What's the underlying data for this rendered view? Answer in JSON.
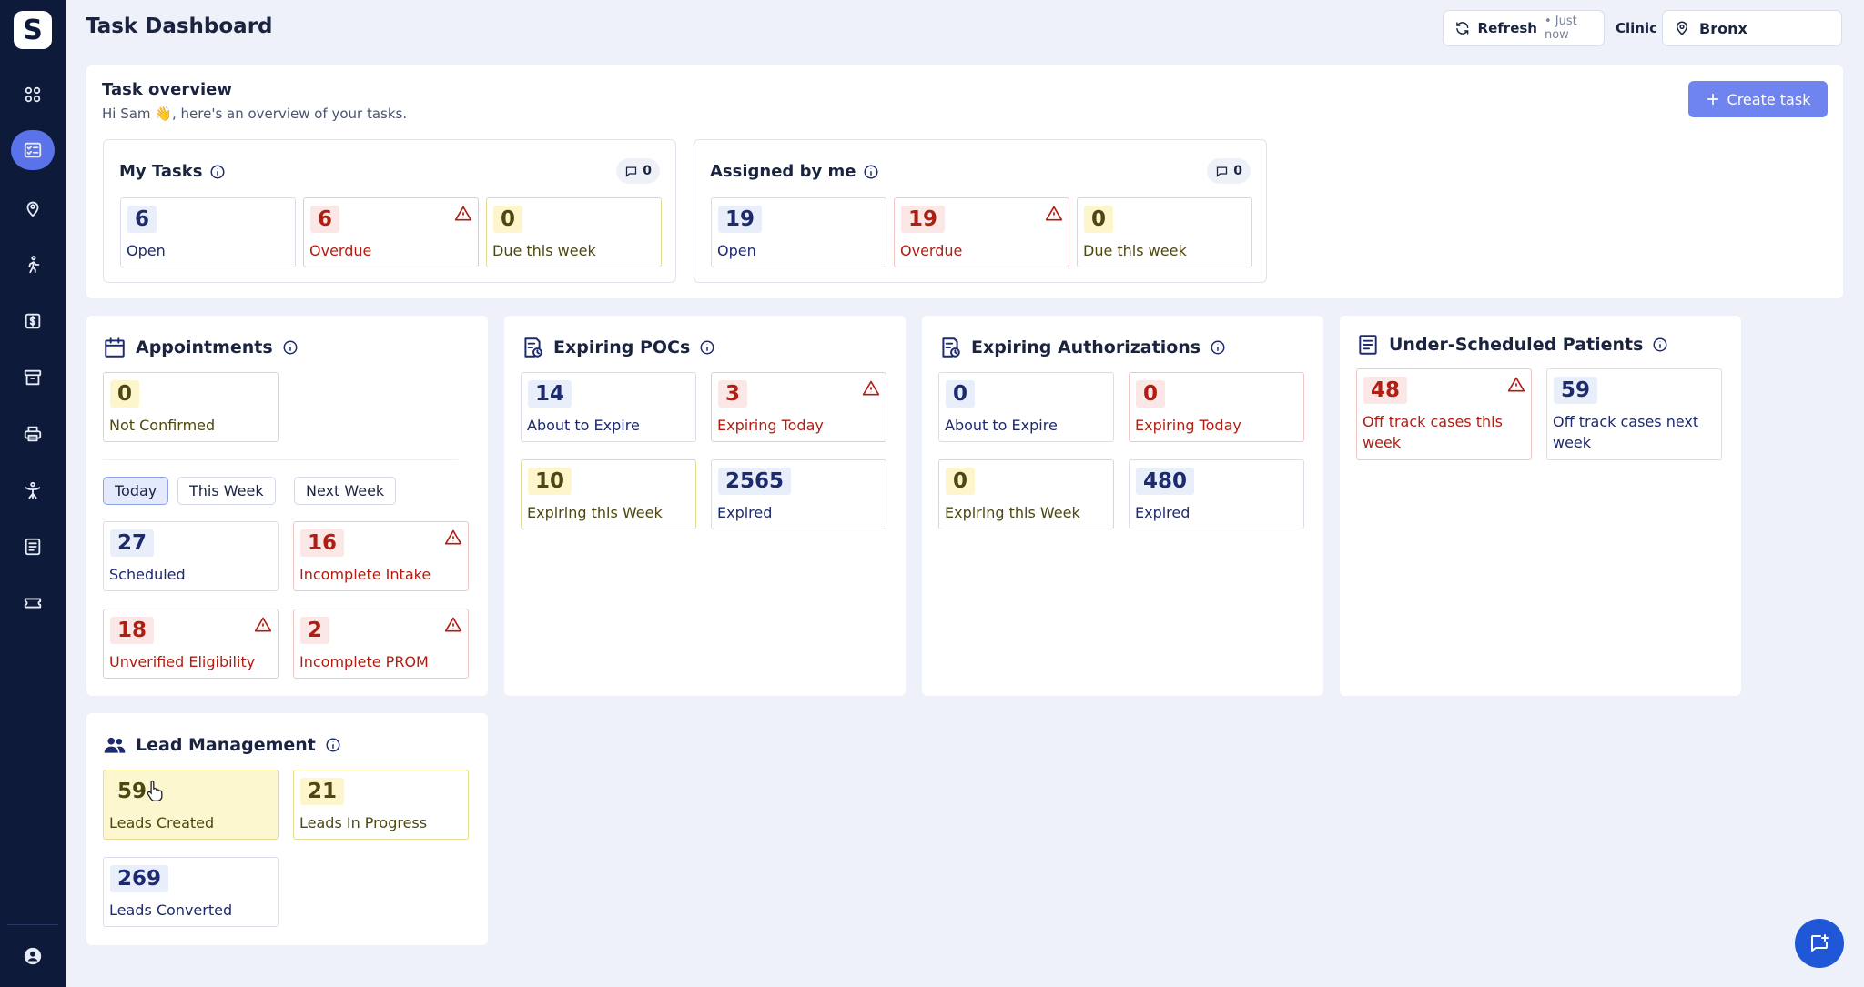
{
  "app": {
    "logo_letter": "S",
    "page_title": "Task Dashboard",
    "accent_color": "#5b73e8"
  },
  "header": {
    "refresh_label": "Refresh",
    "refresh_time": "• Just now",
    "clinic_label": "Clinic :",
    "clinic_value": "Bronx"
  },
  "sidebar": {
    "items": [
      {
        "icon": "dashboard-icon",
        "active": false
      },
      {
        "icon": "tasks-icon",
        "active": true
      },
      {
        "icon": "patient-location-icon",
        "active": false
      },
      {
        "icon": "walking-person-icon",
        "active": false
      },
      {
        "icon": "billing-icon",
        "active": false
      },
      {
        "icon": "archive-icon",
        "active": false
      },
      {
        "icon": "printer-icon",
        "active": false
      },
      {
        "icon": "therapy-icon",
        "active": false
      },
      {
        "icon": "document-icon",
        "active": false
      },
      {
        "icon": "ticket-icon",
        "active": false
      }
    ],
    "bottom_icon": "user-profile-icon"
  },
  "overview": {
    "title": "Task overview",
    "subtitle": "Hi Sam 👋, here's an overview of your tasks.",
    "create_label": "Create task",
    "my_tasks": {
      "title": "My Tasks",
      "comments": "0",
      "open": {
        "value": "6",
        "label": "Open"
      },
      "overdue": {
        "value": "6",
        "label": "Overdue"
      },
      "due": {
        "value": "0",
        "label": "Due this week"
      }
    },
    "assigned": {
      "title": "Assigned by me",
      "comments": "0",
      "open": {
        "value": "19",
        "label": "Open"
      },
      "overdue": {
        "value": "19",
        "label": "Overdue"
      },
      "due": {
        "value": "0",
        "label": "Due this week"
      }
    }
  },
  "appointments": {
    "title": "Appointments",
    "not_confirmed": {
      "value": "0",
      "label": "Not Confirmed"
    },
    "tabs": [
      "Today",
      "This Week",
      "Next Week"
    ],
    "active_tab": "Today",
    "scheduled": {
      "value": "27",
      "label": "Scheduled"
    },
    "incomplete_intake": {
      "value": "16",
      "label": "Incomplete Intake"
    },
    "unverified": {
      "value": "18",
      "label": "Unverified Eligibility"
    },
    "incomplete_prom": {
      "value": "2",
      "label": "Incomplete PROM"
    }
  },
  "pocs": {
    "title": "Expiring POCs",
    "about": {
      "value": "14",
      "label": "About to Expire"
    },
    "today": {
      "value": "3",
      "label": "Expiring Today"
    },
    "week": {
      "value": "10",
      "label": "Expiring this Week"
    },
    "expired": {
      "value": "2565",
      "label": "Expired"
    }
  },
  "auths": {
    "title": "Expiring Authorizations",
    "about": {
      "value": "0",
      "label": "About to Expire"
    },
    "today": {
      "value": "0",
      "label": "Expiring Today"
    },
    "week": {
      "value": "0",
      "label": "Expiring this Week"
    },
    "expired": {
      "value": "480",
      "label": "Expired"
    }
  },
  "underscheduled": {
    "title": "Under-Scheduled Patients",
    "this_week": {
      "value": "48",
      "label": "Off track cases this week"
    },
    "next_week": {
      "value": "59",
      "label": "Off track cases next week"
    }
  },
  "leads": {
    "title": "Lead Management",
    "created": {
      "value": "59",
      "label": "Leads Created"
    },
    "in_progress": {
      "value": "21",
      "label": "Leads In Progress"
    },
    "converted": {
      "value": "269",
      "label": "Leads Converted"
    }
  }
}
